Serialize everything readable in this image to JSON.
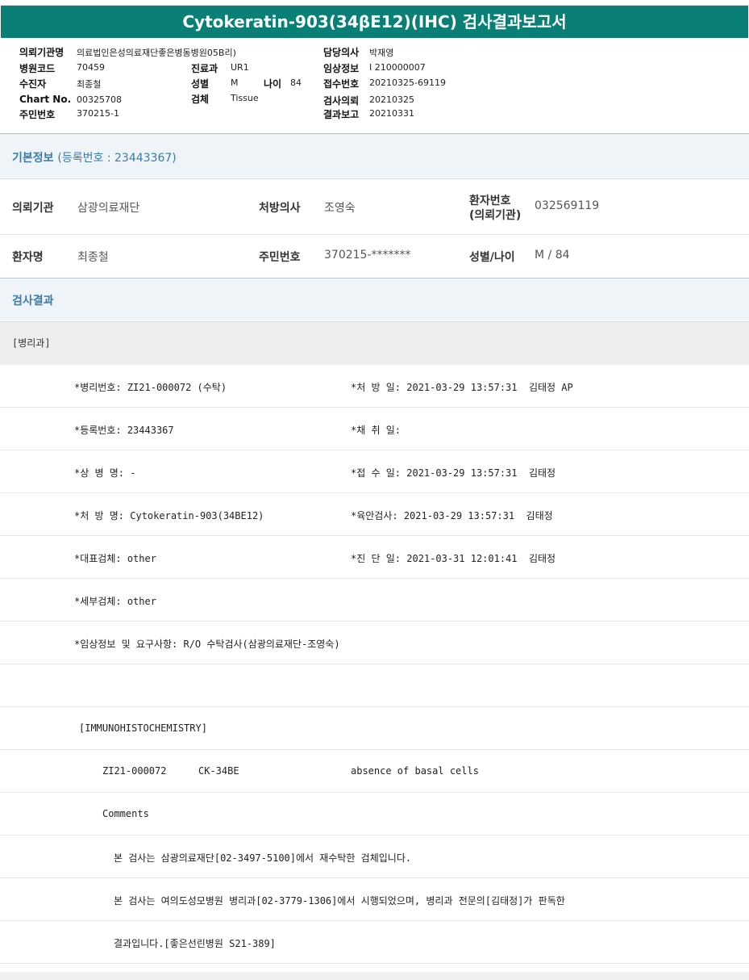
{
  "title": "Cytokeratin-903(34βE12)(IHC) 검사결과보고서",
  "header": {
    "left": [
      {
        "label": "의뢰기관명",
        "value": "의료법인은성의료재단좋은병동병원05B리)"
      },
      {
        "label": "병원코드",
        "value": "70459"
      },
      {
        "label": "수진자",
        "value": "최종철"
      },
      {
        "label": "Chart No.",
        "value": "00325708"
      },
      {
        "label": "주민번호",
        "value": "370215-1"
      }
    ],
    "mid": [
      {
        "label": "진료과",
        "value": "UR1"
      },
      {
        "label": "성별",
        "value": "M"
      },
      {
        "label": "검체",
        "value": "Tissue"
      }
    ],
    "age": {
      "label": "나이",
      "value": "84"
    },
    "right": [
      {
        "label": "담당의사",
        "value": "박재영"
      },
      {
        "label": "임상정보",
        "value": "I 210000007"
      },
      {
        "label": "접수번호",
        "value": "20210325-69119"
      },
      {
        "label": "검사의뢰",
        "value": "20210325"
      },
      {
        "label": "결과보고",
        "value": "20210331"
      }
    ]
  },
  "basic": {
    "heading": "기본정보",
    "reg": "(등록번호 : 23443367)",
    "row1": {
      "l1": "의뢰기관",
      "v1": "삼광의료재단",
      "l2": "처방의사",
      "v2": "조영숙",
      "l3a": "환자번호",
      "l3b": "(의뢰기관)",
      "v3": "032569119"
    },
    "row2": {
      "l1": "환자명",
      "v1": "최종철",
      "l2": "주민번호",
      "v2": "370215-*******",
      "l3": "성별/나이",
      "v3": "M / 84"
    }
  },
  "results": {
    "heading": "검사결과",
    "dept": "[병리과]",
    "rows": [
      {
        "a": "*병리번호: ZI21-000072 (수탁)",
        "b": "*처 방 일: 2021-03-29 13:57:31  김태정 AP"
      },
      {
        "a": "*등록번호: 23443367",
        "b": "*채 취 일:"
      },
      {
        "a": "*상 병 명: -",
        "b": "*접 수 일: 2021-03-29 13:57:31  김태정"
      },
      {
        "a": "*처 방 명: Cytokeratin-903(34BE12)",
        "b": "*육안검사: 2021-03-29 13:57:31  김태정"
      },
      {
        "a": "*대표검체: other",
        "b": "*진 단 일: 2021-03-31 12:01:41  김태정"
      },
      {
        "a": "*세부검체: other",
        "b": ""
      },
      {
        "a": "*임상정보 및 요구사항: R/O 수탁검사(삼광의료재단-조영숙)",
        "b": ""
      }
    ],
    "ihc_title": "[IMMUNOHISTOCHEMISTRY]",
    "ihc_row": {
      "id": "ZI21-000072",
      "marker": "CK-34BE",
      "result": "absence of basal cells"
    },
    "comments_label": "Comments",
    "comment1": "본 검사는 삼광의료재단[02-3497-5100]에서 재수탁한 검체입니다.",
    "comment2": "본 검사는 여의도성모병원 병리과[02-3779-1306]에서 시행되었으며, 병리과 전문의[김태정]가 판독한",
    "comment3": "결과입니다.[좋은선린병원 S21-389]"
  }
}
